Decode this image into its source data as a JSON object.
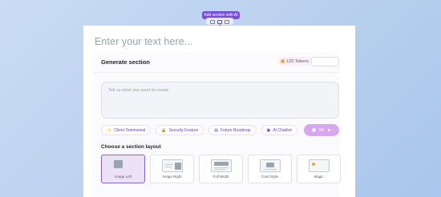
{
  "tooltip": {
    "label": "Add section with AI"
  },
  "mini_toolbar": {
    "icons": [
      "text-block-icon",
      "ai-sparkle-icon",
      "layout-grid-icon"
    ]
  },
  "editor": {
    "placeholder": "Enter your text here..."
  },
  "generate": {
    "title": "Generate section",
    "tokens_label": "120 Tokens",
    "prompt_placeholder": "Tell us what you want to create",
    "suggestions": [
      {
        "icon": "✨",
        "label": "Client Testimonial"
      },
      {
        "icon": "🔒",
        "label": "Security Feature"
      },
      {
        "icon": "▤",
        "label": "Future Roadmap"
      },
      {
        "icon": "▣",
        "label": "AI Chatbot"
      }
    ],
    "generate_button": {
      "cost": "50",
      "icon": "play-icon"
    }
  },
  "layout_section": {
    "title": "Choose a section layout",
    "options": [
      {
        "label": "Image Left",
        "selected": true
      },
      {
        "label": "Image Right",
        "selected": false
      },
      {
        "label": "Full Width",
        "selected": false
      },
      {
        "label": "Card Style",
        "selected": false
      },
      {
        "label": "Magic",
        "selected": false
      }
    ]
  },
  "colors": {
    "accent": "#7c4dd6",
    "selected_bg": "#ece2f8",
    "generate_button": "#d7a8f0"
  }
}
